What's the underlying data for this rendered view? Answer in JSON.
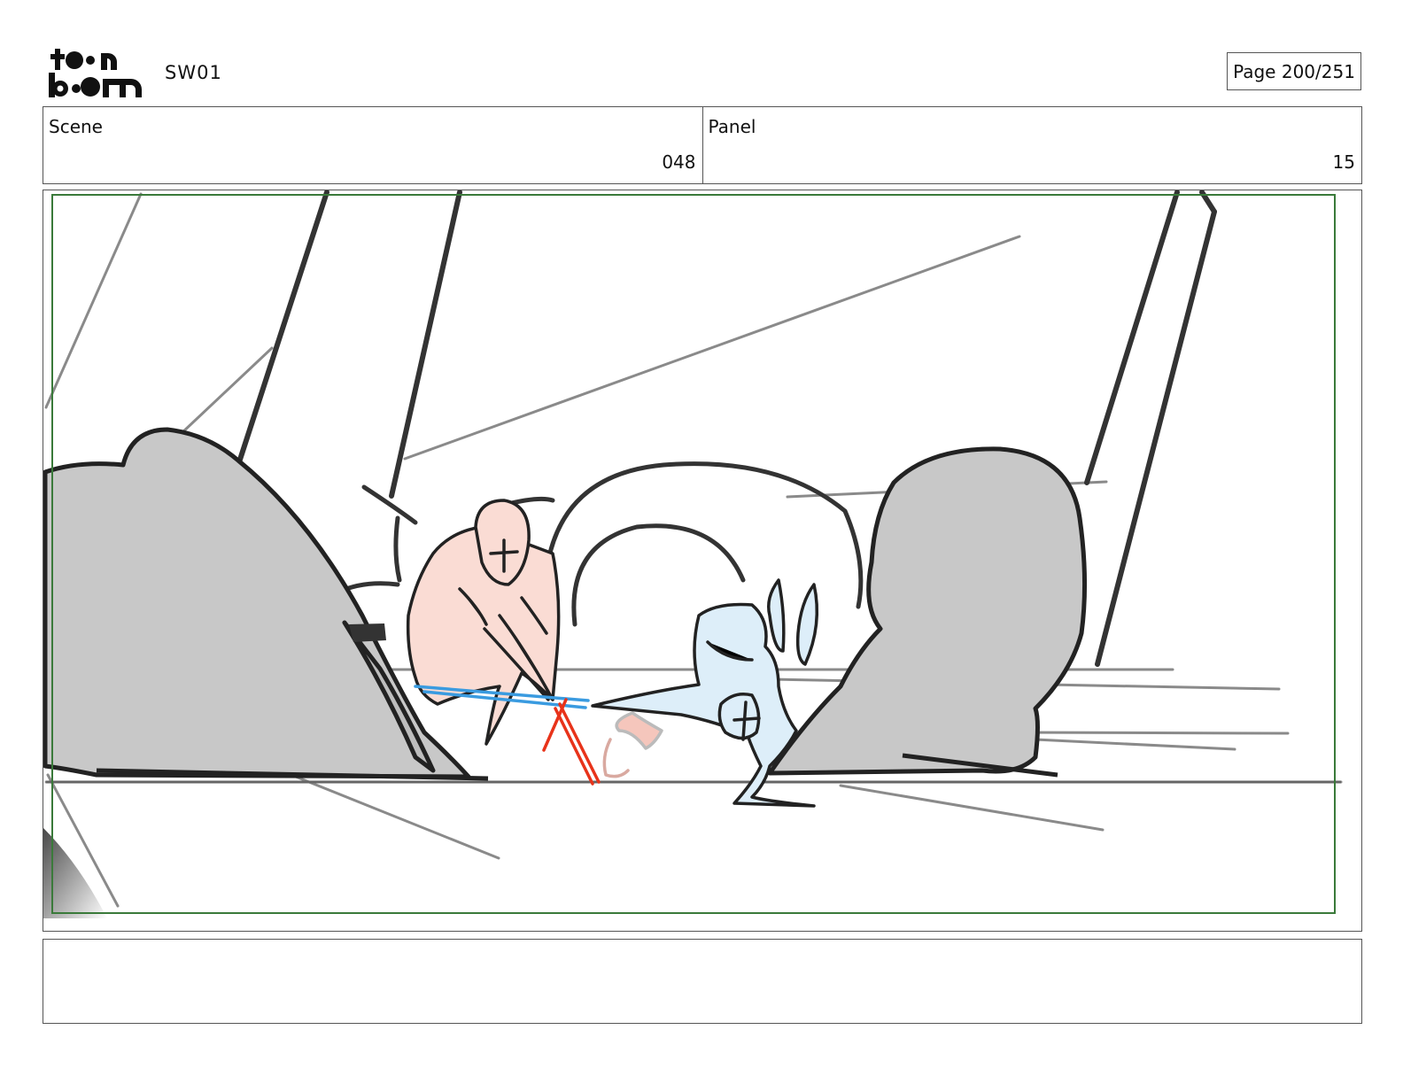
{
  "header": {
    "project_code": "SW01",
    "page_label": "Page 200/251"
  },
  "info": {
    "scene_label": "Scene",
    "scene_value": "048",
    "panel_label": "Panel",
    "panel_value": "15"
  },
  "notes": {
    "text": ""
  },
  "colors": {
    "safe_frame": "#3a7a3a",
    "ink": "#333333",
    "rock_fill": "#c8c8c8",
    "figure_left_fill": "#fadcd4",
    "figure_right_fill": "#ddeef9",
    "saber_blue": "#3a9be0",
    "saber_red": "#e8331a"
  }
}
